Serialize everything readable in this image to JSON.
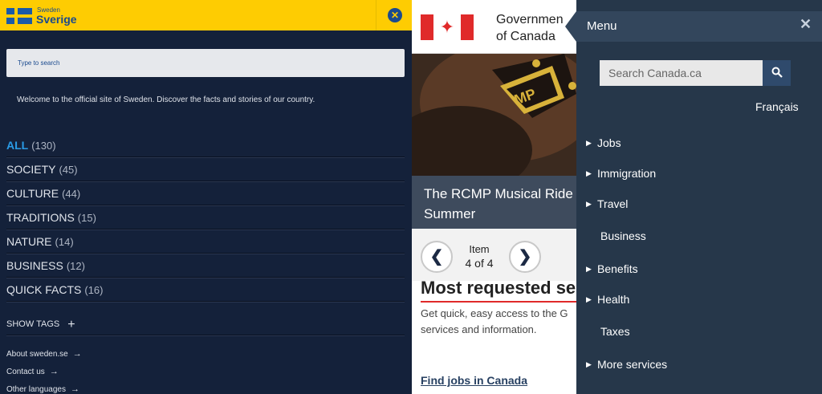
{
  "sweden": {
    "brand_small": "Sweden",
    "brand_big": "Sverige",
    "close_glyph": "✕",
    "search_placeholder": "Type to search",
    "welcome": "Welcome to the official site of Sweden. Discover the facts and stories of our country.",
    "categories": [
      {
        "name": "ALL",
        "count": "(130)"
      },
      {
        "name": "SOCIETY",
        "count": "(45)"
      },
      {
        "name": "CULTURE",
        "count": "(44)"
      },
      {
        "name": "TRADITIONS",
        "count": "(15)"
      },
      {
        "name": "NATURE",
        "count": "(14)"
      },
      {
        "name": "BUSINESS",
        "count": "(12)"
      },
      {
        "name": "QUICK FACTS",
        "count": "(16)"
      }
    ],
    "show_tags": "SHOW TAGS",
    "links": [
      "About sweden.se",
      "Contact us",
      "Other languages"
    ],
    "colors": {
      "header": "#fecc02",
      "background": "#14213a",
      "accent": "#2a9be6"
    }
  },
  "canada": {
    "gov_line1": "Governmen",
    "gov_line2": "of Canada",
    "leaf_glyph": "✦",
    "caption_line1": "The RCMP Musical Ride",
    "caption_line2": "Summer",
    "item_label": "Item",
    "item_count": "4 of 4",
    "prev_glyph": "❮",
    "next_glyph": "❯",
    "most_requested": "Most requested se",
    "desc_line1": "Get quick, easy access to the G",
    "desc_line2": "services and information.",
    "find_jobs": "Find jobs in Canada"
  },
  "menu": {
    "title": "Menu",
    "close_glyph": "✕",
    "search_placeholder": "Search Canada.ca",
    "language": "Français",
    "items": [
      {
        "label": "Jobs",
        "expandable": true
      },
      {
        "label": "Immigration",
        "expandable": true
      },
      {
        "label": "Travel",
        "expandable": true
      },
      {
        "label": "Business",
        "expandable": false
      },
      {
        "label": "Benefits",
        "expandable": true
      },
      {
        "label": "Health",
        "expandable": true
      },
      {
        "label": "Taxes",
        "expandable": false
      },
      {
        "label": "More services",
        "expandable": true
      }
    ]
  }
}
